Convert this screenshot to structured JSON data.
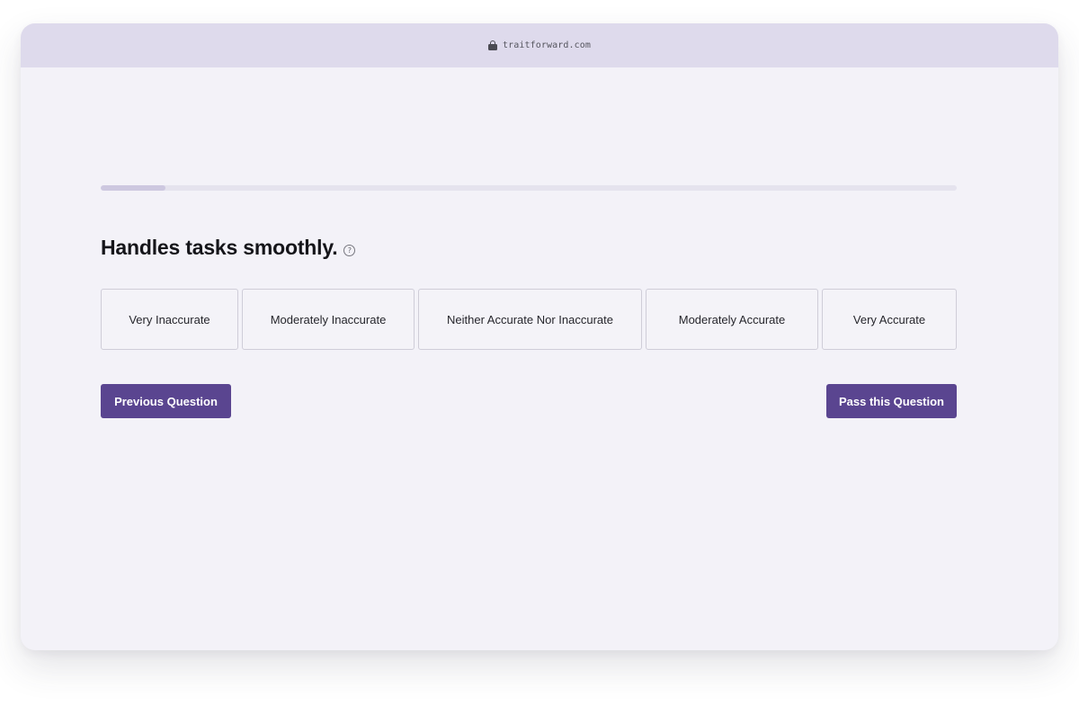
{
  "browser": {
    "url": "traitforward.com",
    "lock_icon": "lock-icon"
  },
  "progress": {
    "fraction": 0.076
  },
  "question": {
    "text": "Handles tasks smoothly.",
    "help_icon": "help-circle-icon",
    "help_glyph": "?"
  },
  "options": [
    "Very Inaccurate",
    "Moderately Inaccurate",
    "Neither Accurate Nor Inaccurate",
    "Moderately Accurate",
    "Very Accurate"
  ],
  "buttons": {
    "previous_label": "Previous Question",
    "pass_label": "Pass this Question"
  },
  "colors": {
    "accent": "#5a4590",
    "titlebar": "#dedaec",
    "background": "#f3f2f8",
    "progress_fill": "#cdc8e0",
    "progress_track": "#e5e3ee"
  }
}
